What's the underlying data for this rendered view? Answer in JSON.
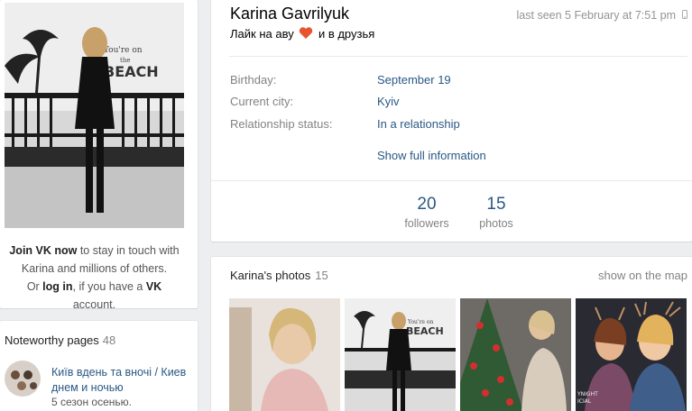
{
  "left": {
    "join": {
      "join_link": "Join VK now",
      "text1": " to stay in touch with Karina and millions of others.",
      "or": "Or ",
      "login_link": "log in",
      "text2": ", if you have a ",
      "vk": "VK",
      "text3": " account."
    },
    "noteworthy": {
      "title": "Noteworthy pages",
      "count": "48",
      "item": {
        "name": "Київ вдень та вночі / Киев днем и ночью",
        "desc": "5 сезон осенью."
      }
    }
  },
  "profile": {
    "name": "Karina Gavrilyuk",
    "status_before": "Лайк на аву",
    "status_after": "и в друзья",
    "last_seen": "last seen 5 February at 7:51 pm",
    "info": [
      {
        "label": "Birthday:",
        "value": "September 19"
      },
      {
        "label": "Current city:",
        "value": "Kyiv"
      },
      {
        "label": "Relationship status:",
        "value": "In a relationship"
      }
    ],
    "show_full": "Show full information",
    "counters": [
      {
        "num": "20",
        "label": "followers"
      },
      {
        "num": "15",
        "label": "photos"
      }
    ]
  },
  "photos": {
    "title": "Karina's photos",
    "count": "15",
    "map_link": "show on the map"
  },
  "colors": {
    "link": "#2a5885",
    "muted": "#828282",
    "background": "#edeef0"
  }
}
